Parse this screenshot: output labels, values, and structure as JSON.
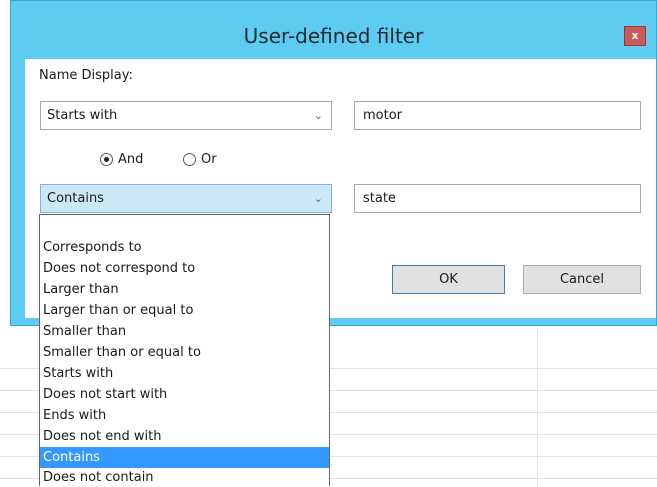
{
  "window": {
    "title": "User-defined filter",
    "close_glyph": "x"
  },
  "field_label": "Name Display:",
  "condition1": {
    "operator": "Starts with",
    "value": "motor"
  },
  "logic": {
    "and_label": "And",
    "or_label": "Or",
    "selected": "And"
  },
  "condition2": {
    "operator": "Contains",
    "value": "state"
  },
  "buttons": {
    "ok": "OK",
    "cancel": "Cancel"
  },
  "dropdown": {
    "options": [
      "Corresponds to",
      "Does not correspond to",
      "Larger than",
      "Larger than or equal to",
      "Smaller than",
      "Smaller than or equal to",
      "Starts with",
      "Does not start with",
      "Ends with",
      "Does not end with",
      "Contains",
      "Does not contain"
    ],
    "selected": "Contains"
  },
  "colors": {
    "titlebar": "#5ecbf0",
    "close_button": "#c85a5a",
    "selection": "#3399ff",
    "open_combo": "#cce8f6"
  },
  "icons": {
    "chevron": "chevron-down-icon",
    "close": "close-icon"
  }
}
